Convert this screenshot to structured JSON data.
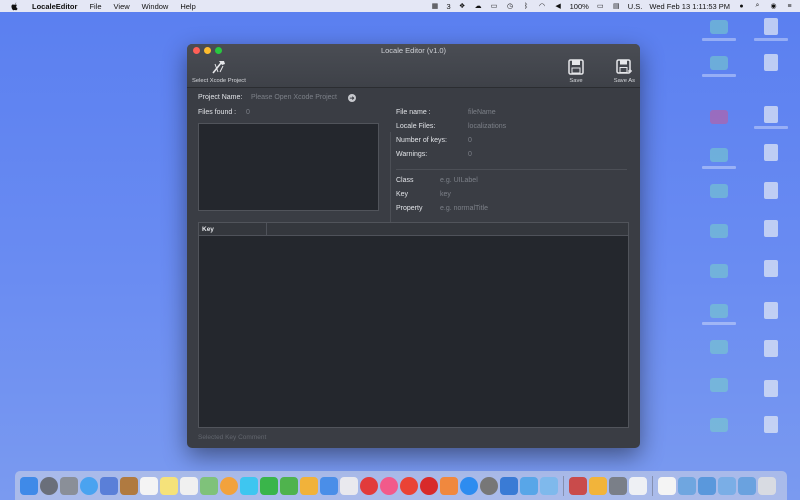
{
  "menubar": {
    "app_name": "LocaleEditor",
    "menus": [
      "File",
      "View",
      "Window",
      "Help"
    ],
    "badge_count": "3",
    "battery": "100%",
    "input_source": "U.S.",
    "clock": "Wed Feb 13  1:11:53 PM"
  },
  "window": {
    "title": "Locale Editor (v1.0)",
    "toolbar": {
      "select_project_label": "Select Xcode Project",
      "save_label": "Save",
      "save_as_label": "Save As"
    },
    "project": {
      "label": "Project Name:",
      "placeholder": "Please Open Xcode Project"
    },
    "files_found": {
      "label": "Files found :",
      "value": "0"
    },
    "file_info": {
      "file_name_label": "File name :",
      "file_name_value": "fileName",
      "locale_files_label": "Locale Files:",
      "locale_files_value": "localizations",
      "num_keys_label": "Number of keys:",
      "num_keys_value": "0",
      "warnings_label": "Warnings:",
      "warnings_value": "0"
    },
    "filters": {
      "class_label": "Class",
      "class_placeholder": "e.g. UILabel",
      "key_label": "Key",
      "key_placeholder": "key",
      "property_label": "Property",
      "property_placeholder": "e.g. normalTitle"
    },
    "table": {
      "columns": [
        "Key",
        ""
      ]
    },
    "footer": {
      "selected_key_comment": "Selected Key Comment"
    }
  },
  "colors": {
    "desktop": "#6a8cf2",
    "window_bg": "#3a3d44",
    "panel_bg": "#24272d",
    "close": "#ff5f57",
    "minimize": "#febc2e",
    "maximize": "#28c840"
  }
}
